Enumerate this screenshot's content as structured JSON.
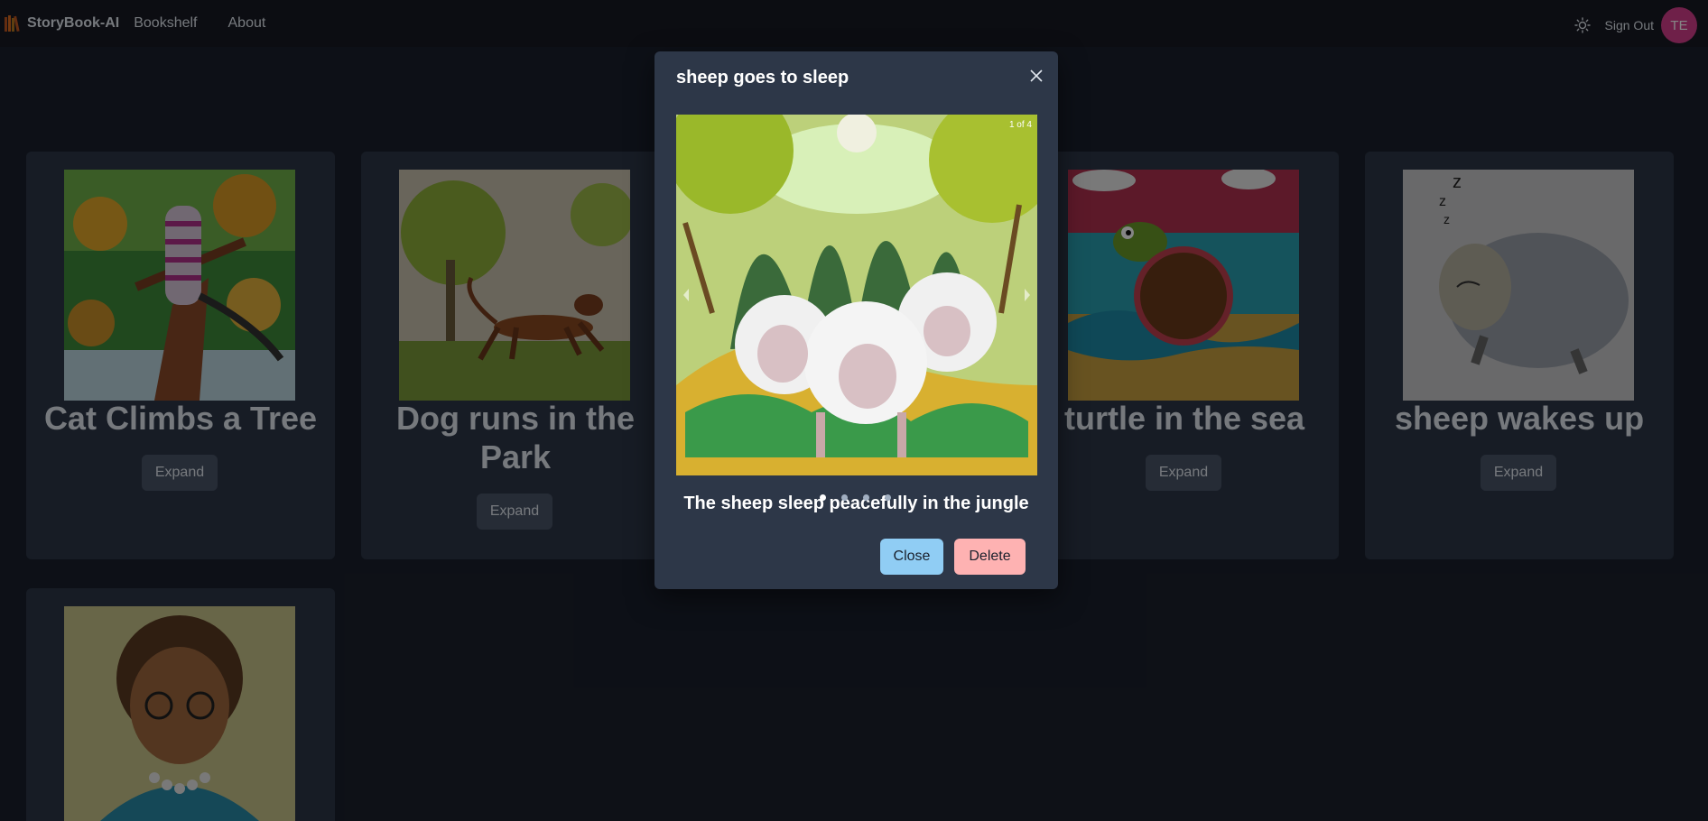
{
  "nav": {
    "brand": "StoryBook-AI",
    "links": [
      "Bookshelf",
      "About"
    ],
    "sign_out": "Sign Out",
    "avatar_initials": "TE",
    "theme_icon": "sun-icon"
  },
  "cards": [
    {
      "title": "Cat Climbs a Tree",
      "button": "Expand"
    },
    {
      "title": "Dog runs in the Park",
      "button": "Expand"
    },
    {
      "title": "turtle in the sea",
      "button": "Expand"
    },
    {
      "title": "sheep wakes up",
      "button": "Expand"
    }
  ],
  "modal": {
    "title": "sheep goes to sleep",
    "counter": "1 of 4",
    "caption": "The sheep sleep peacefully in the jungle",
    "close_label": "Close",
    "delete_label": "Delete",
    "slide_count": 4,
    "active_slide": 1
  },
  "colors": {
    "background": "#1a202c",
    "card": "#2d3748",
    "close_button": "#90cdf4",
    "delete_button": "#feb2b2",
    "avatar": "#d53f8c"
  }
}
